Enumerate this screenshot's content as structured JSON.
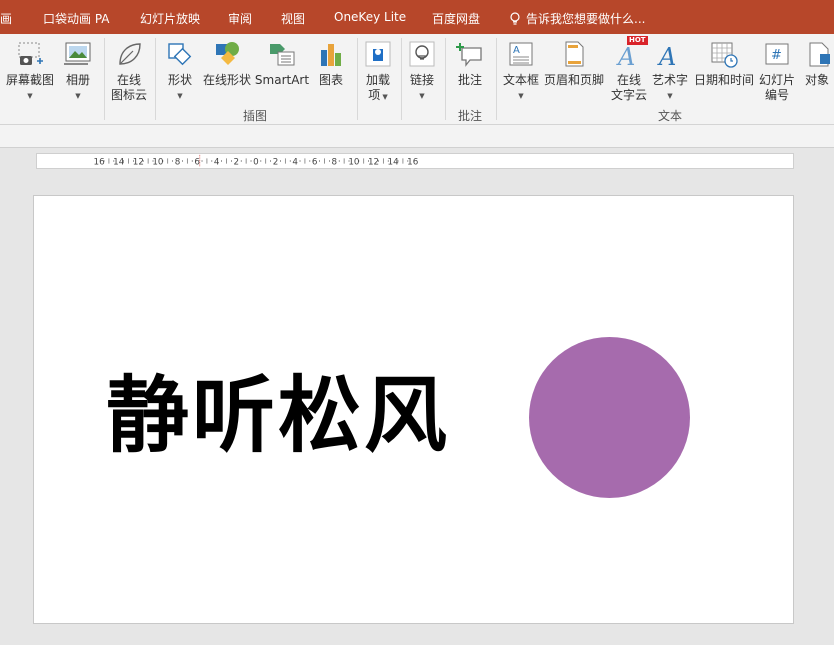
{
  "tabs": [
    {
      "label": "画"
    },
    {
      "label": "口袋动画 PA"
    },
    {
      "label": "幻灯片放映"
    },
    {
      "label": "审阅"
    },
    {
      "label": "视图"
    },
    {
      "label": "OneKey Lite"
    },
    {
      "label": "百度网盘"
    }
  ],
  "tell_me": "告诉我您想要做什么...",
  "ribbon": {
    "screenshot": "屏幕截图",
    "album": "相册",
    "online_icon_1": "在线",
    "online_icon_2": "图标云",
    "shapes": "形状",
    "online_shapes": "在线形状",
    "smartart": "SmartArt",
    "chart": "图表",
    "addins_1": "加载",
    "addins_2": "项",
    "link": "链接",
    "comment": "批注",
    "textbox": "文本框",
    "header_footer": "页眉和页脚",
    "online_text_1": "在线",
    "online_text_2": "文字云",
    "hot_badge": "HOT",
    "wordart": "艺术字",
    "datetime": "日期和时间",
    "slide_number_1": "幻灯片",
    "slide_number_2": "编号",
    "object": "对象",
    "group_illustrations": "插图",
    "group_comments": "批注",
    "group_text": "文本"
  },
  "ruler": {
    "ticks": [
      "16",
      "14",
      "12",
      "10",
      "8",
      "6",
      "4",
      "2",
      "0",
      "2",
      "4",
      "6",
      "8",
      "10",
      "12",
      "14",
      "16"
    ]
  },
  "slide": {
    "title": "静听松风",
    "circle_color": "#a66bad"
  },
  "colors": {
    "tab_bar": "#b7472a",
    "accent_blue": "#2e75b6"
  }
}
